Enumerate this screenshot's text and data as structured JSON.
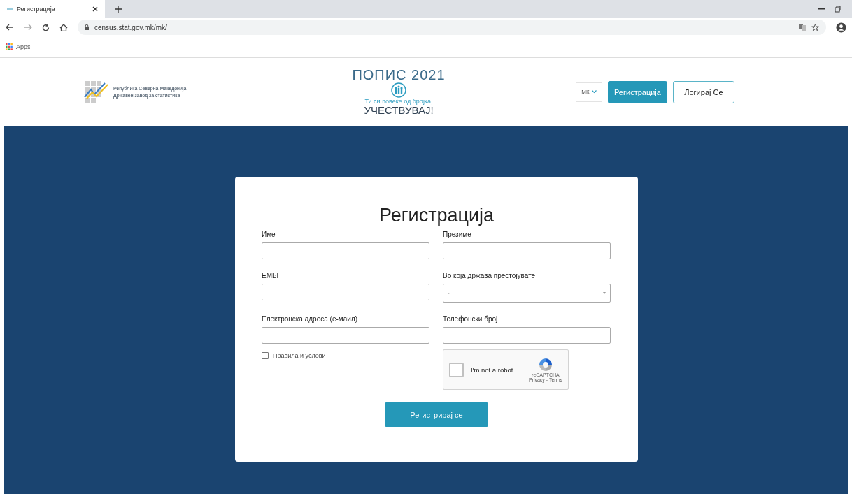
{
  "browser": {
    "tab_title": "Регистрација",
    "url": "census.stat.gov.mk/mk/",
    "bookmarks": [
      "Apps"
    ]
  },
  "header": {
    "org_lines": [
      "Република Северна Македонија",
      "Државен завод за статистика"
    ],
    "census_title": "ПОПИС 2021",
    "census_slogan": "Ти си повеќе од бројка,",
    "census_call": "УЧЕСТВУВАЈ!",
    "language": "МК",
    "register_button": "Регистрација",
    "login_button": "Логирај Се"
  },
  "form": {
    "title": "Регистрација",
    "fields": [
      {
        "label": "Име",
        "kind": "text"
      },
      {
        "label": "Презиме",
        "kind": "text"
      },
      {
        "label": "ЕМБГ",
        "kind": "text"
      },
      {
        "label": "Во која држава престојувате",
        "kind": "select",
        "value": "-"
      },
      {
        "label": "Електронска адреса (е-маил)",
        "kind": "text"
      },
      {
        "label": "Телефонски број",
        "kind": "text"
      }
    ],
    "terms": {
      "label": "Правила и услови",
      "checked": false
    },
    "captcha": {
      "label": "I'm not a robot",
      "brand": "reCAPTCHA",
      "links": "Privacy - Terms",
      "checked": false
    },
    "submit": "Регистрирај се"
  }
}
